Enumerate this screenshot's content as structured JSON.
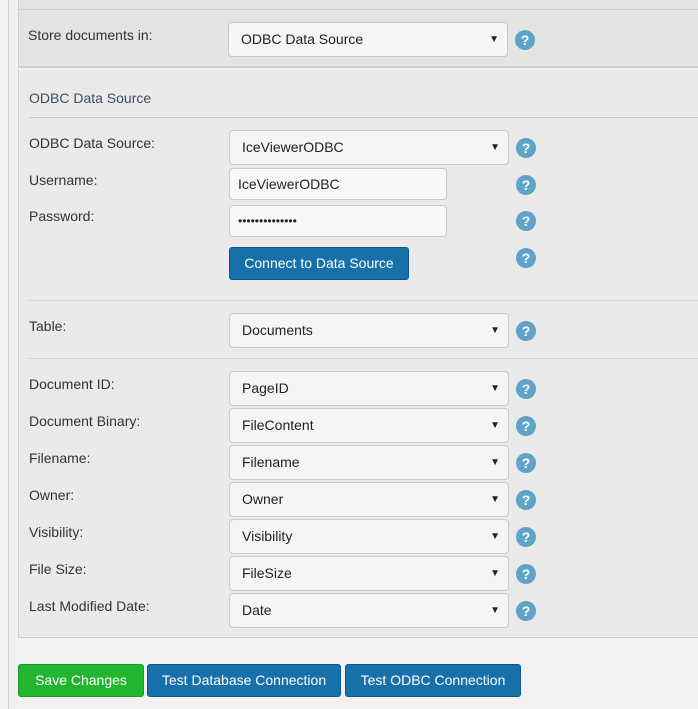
{
  "store": {
    "label": "Store documents in:",
    "value": "ODBC Data Source"
  },
  "odbc": {
    "legend": "ODBC Data Source",
    "source_label": "ODBC Data Source:",
    "source_value": "IceViewerODBC",
    "username_label": "Username:",
    "username_value": "IceViewerODBC",
    "password_label": "Password:",
    "password_value": "••••••••••••••",
    "connect_button": "Connect to Data Source"
  },
  "table": {
    "label": "Table:",
    "value": "Documents"
  },
  "fields": [
    {
      "label": "Document ID:",
      "value": "PageID"
    },
    {
      "label": "Document Binary:",
      "value": "FileContent"
    },
    {
      "label": "Filename:",
      "value": "Filename"
    },
    {
      "label": "Owner:",
      "value": "Owner"
    },
    {
      "label": "Visibility:",
      "value": "Visibility"
    },
    {
      "label": "File Size:",
      "value": "FileSize"
    },
    {
      "label": "Last Modified Date:",
      "value": "Date"
    }
  ],
  "help_glyph": "?",
  "caret_glyph": "▼",
  "footer": {
    "save": "Save Changes",
    "test_db": "Test Database Connection",
    "test_odbc": "Test ODBC Connection"
  },
  "colors": {
    "primary_blue": "#1770aa",
    "save_green": "#22b52f",
    "help_icon": "#5fa3c9"
  }
}
